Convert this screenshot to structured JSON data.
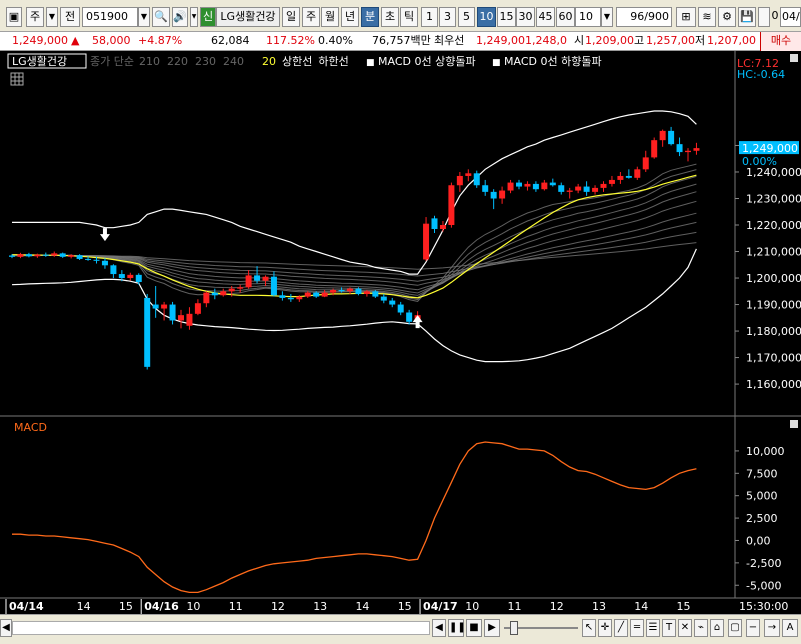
{
  "toolbar": {
    "market_btn": "주",
    "prev_btn": "전",
    "stock_code": "051900",
    "info_badge": "신",
    "stock_name": "LG생활건강",
    "periods": [
      "일",
      "주",
      "월",
      "년",
      "분",
      "초",
      "틱"
    ],
    "selected_period": "분",
    "intervals": [
      "1",
      "3",
      "5",
      "10",
      "15",
      "30",
      "45",
      "60"
    ],
    "selected_interval": "10",
    "interval_select": "10",
    "count_value": "96",
    "count_max": "/900",
    "checkbox_value": "0",
    "date_field": "04/"
  },
  "quote": {
    "price": "1,249,000",
    "change": "58,000",
    "change_pct": "+4.87%",
    "volume": "62,084",
    "volume_ratio": "117.52%",
    "turnover": "0.40%",
    "amount": "76,757백만",
    "best_label": "최우선",
    "ask": "1,249,00",
    "bid": "1,248,0",
    "open_label": "시",
    "open": "1,209,00",
    "high_label": "고",
    "high": "1,257,00",
    "low_label": "저",
    "low": "1,207,00",
    "buy_btn": "매수"
  },
  "legend": {
    "stock": "LG생활건강",
    "ma_label": "종가 단순",
    "ma_periods": [
      "210",
      "220",
      "230",
      "240"
    ],
    "ma_last": "20",
    "upper_band": "상한선",
    "lower_band": "하한선",
    "signal_up": "MACD 0선 상향돌파",
    "signal_down": "MACD 0선 하향돌파"
  },
  "overlay": {
    "lc": "LC:7.12",
    "hc": "HC:-0.64",
    "current_price": "1,249,000",
    "current_pct": "0.00%",
    "macd_label": "MACD"
  },
  "colors": {
    "background": "#000000",
    "up": "#ff2020",
    "down": "#00bfff",
    "band": "#ffffff",
    "ma20": "#ffff33",
    "macd": "#ff6a1a",
    "price_tag": "#00bfff"
  },
  "chart_data": [
    {
      "type": "candlestick",
      "title": "",
      "yticks": [
        1160000,
        1170000,
        1180000,
        1190000,
        1200000,
        1210000,
        1220000,
        1230000,
        1240000,
        1250000
      ],
      "ytick_labels": [
        "1,160,000",
        "1,170,000",
        "1,180,000",
        "1,190,000",
        "1,200,000",
        "1,210,000",
        "1,220,000",
        "1,230,000",
        "1,240,000",
        "1,250,000"
      ],
      "ylim": [
        1154000,
        1263000
      ],
      "x_labels": [
        "04/14",
        "14",
        "15",
        "04/16",
        "10",
        "11",
        "12",
        "13",
        "14",
        "15",
        "04/17",
        "10",
        "11",
        "12",
        "13",
        "14",
        "15"
      ],
      "x_label_index": [
        0,
        8,
        13,
        16,
        21,
        26,
        31,
        36,
        41,
        46,
        49,
        54,
        59,
        64,
        69,
        74,
        79
      ],
      "time_label": "15:30:00",
      "candles": [
        [
          1208500,
          1209000,
          1207500,
          1208000
        ],
        [
          1208000,
          1209500,
          1207500,
          1209000
        ],
        [
          1209000,
          1209500,
          1207800,
          1208200
        ],
        [
          1208200,
          1209200,
          1207600,
          1208800
        ],
        [
          1208800,
          1209600,
          1208000,
          1208500
        ],
        [
          1208500,
          1210000,
          1208000,
          1209300
        ],
        [
          1209300,
          1209600,
          1207600,
          1208000
        ],
        [
          1208000,
          1209000,
          1207400,
          1208600
        ],
        [
          1208600,
          1209000,
          1206800,
          1207200
        ],
        [
          1207200,
          1208200,
          1206500,
          1206900
        ],
        [
          1206900,
          1208000,
          1205500,
          1206500
        ],
        [
          1206500,
          1207500,
          1203500,
          1204800
        ],
        [
          1204800,
          1205200,
          1200000,
          1201500
        ],
        [
          1201500,
          1203000,
          1198800,
          1200000
        ],
        [
          1200000,
          1202000,
          1199000,
          1201200
        ],
        [
          1201200,
          1201800,
          1197500,
          1198500
        ],
        [
          1192500,
          1194000,
          1165500,
          1166500
        ],
        [
          1190000,
          1197000,
          1185000,
          1188500
        ],
        [
          1188500,
          1191000,
          1184000,
          1190000
        ],
        [
          1190000,
          1191000,
          1182500,
          1184000
        ],
        [
          1184000,
          1188000,
          1181000,
          1186000
        ],
        [
          1182000,
          1189000,
          1180500,
          1186500
        ],
        [
          1186500,
          1192000,
          1186000,
          1190500
        ],
        [
          1190500,
          1195000,
          1189000,
          1194500
        ],
        [
          1194500,
          1196000,
          1192000,
          1193500
        ],
        [
          1193500,
          1196000,
          1193000,
          1195000
        ],
        [
          1195000,
          1197000,
          1193000,
          1196000
        ],
        [
          1196000,
          1197500,
          1194500,
          1196500
        ],
        [
          1196500,
          1203000,
          1196000,
          1201000
        ],
        [
          1201000,
          1204500,
          1198000,
          1199000
        ],
        [
          1199000,
          1201000,
          1197000,
          1200500
        ],
        [
          1200500,
          1202500,
          1193000,
          1193500
        ],
        [
          1193500,
          1195000,
          1191500,
          1192500
        ],
        [
          1192500,
          1194000,
          1191000,
          1192000
        ],
        [
          1192000,
          1193500,
          1191000,
          1193000
        ],
        [
          1193000,
          1195000,
          1192500,
          1194500
        ],
        [
          1194500,
          1195000,
          1192500,
          1193000
        ],
        [
          1193000,
          1195500,
          1192800,
          1194500
        ],
        [
          1194500,
          1196000,
          1193500,
          1195500
        ],
        [
          1195500,
          1196500,
          1194500,
          1195000
        ],
        [
          1195000,
          1196500,
          1194000,
          1196000
        ],
        [
          1196000,
          1196500,
          1193500,
          1194000
        ],
        [
          1194000,
          1195500,
          1193000,
          1195000
        ],
        [
          1195000,
          1195500,
          1192500,
          1193000
        ],
        [
          1193000,
          1194000,
          1190500,
          1191500
        ],
        [
          1191500,
          1192500,
          1189000,
          1190000
        ],
        [
          1190000,
          1191000,
          1186000,
          1187000
        ],
        [
          1187000,
          1188000,
          1182500,
          1183500
        ],
        [
          1183500,
          1187500,
          1182500,
          1186000
        ],
        [
          1207000,
          1223000,
          1206500,
          1220500
        ],
        [
          1222500,
          1223500,
          1217000,
          1218500
        ],
        [
          1218500,
          1221500,
          1217500,
          1220000
        ],
        [
          1220000,
          1236000,
          1219000,
          1235000
        ],
        [
          1235000,
          1240000,
          1232500,
          1238500
        ],
        [
          1238500,
          1241000,
          1236500,
          1239500
        ],
        [
          1239500,
          1240500,
          1234000,
          1235000
        ],
        [
          1235000,
          1237000,
          1231000,
          1232500
        ],
        [
          1232500,
          1233500,
          1226000,
          1230000
        ],
        [
          1230000,
          1234500,
          1228000,
          1233000
        ],
        [
          1233000,
          1237000,
          1232000,
          1236000
        ],
        [
          1236000,
          1237000,
          1233500,
          1234500
        ],
        [
          1234500,
          1236500,
          1233000,
          1235500
        ],
        [
          1235500,
          1236500,
          1232500,
          1233500
        ],
        [
          1233500,
          1237000,
          1233000,
          1236000
        ],
        [
          1236000,
          1237500,
          1234500,
          1235000
        ],
        [
          1235000,
          1236000,
          1231500,
          1232500
        ],
        [
          1232500,
          1234000,
          1230000,
          1233000
        ],
        [
          1233000,
          1235500,
          1232000,
          1234500
        ],
        [
          1234500,
          1236500,
          1231000,
          1232500
        ],
        [
          1232500,
          1235000,
          1231500,
          1234000
        ],
        [
          1234000,
          1236500,
          1232500,
          1235500
        ],
        [
          1235500,
          1238500,
          1234500,
          1237000
        ],
        [
          1237000,
          1240000,
          1235500,
          1238500
        ],
        [
          1238500,
          1241000,
          1237500,
          1237800
        ],
        [
          1237800,
          1242000,
          1237000,
          1241000
        ],
        [
          1241000,
          1248000,
          1240000,
          1245500
        ],
        [
          1245500,
          1253000,
          1245000,
          1252000
        ],
        [
          1252000,
          1256000,
          1249500,
          1255500
        ],
        [
          1255500,
          1257000,
          1250000,
          1250500
        ],
        [
          1250500,
          1253000,
          1246000,
          1247500
        ],
        [
          1247500,
          1249000,
          1244000,
          1248000
        ],
        [
          1248000,
          1251000,
          1246500,
          1249000
        ]
      ],
      "ma20": [
        1208800,
        1208800,
        1208700,
        1208700,
        1208600,
        1208600,
        1208500,
        1208400,
        1208200,
        1208000,
        1207700,
        1207400,
        1207000,
        1206500,
        1206000,
        1205300,
        1203500,
        1202000,
        1200700,
        1199300,
        1198000,
        1196800,
        1195800,
        1195000,
        1194400,
        1194000,
        1193700,
        1193500,
        1193500,
        1193500,
        1193400,
        1193300,
        1193100,
        1193000,
        1193000,
        1193300,
        1193600,
        1193800,
        1194000,
        1194000,
        1194100,
        1194200,
        1194300,
        1194200,
        1194000,
        1193700,
        1193300,
        1192800,
        1192500,
        1193500,
        1194800,
        1196200,
        1198400,
        1200800,
        1203200,
        1205400,
        1207600,
        1209700,
        1211900,
        1214100,
        1216400,
        1218500,
        1220600,
        1222700,
        1224700,
        1226500,
        1228200,
        1229500,
        1230300,
        1230900,
        1231400,
        1231700,
        1232000,
        1232300,
        1232700,
        1233400,
        1234300,
        1235400,
        1236300,
        1237100,
        1238000,
        1238800
      ],
      "bb_upper": [
        1221000,
        1221000,
        1221000,
        1221000,
        1221000,
        1221000,
        1221000,
        1221000,
        1221000,
        1220500,
        1220000,
        1219000,
        1219000,
        1219500,
        1220000,
        1221000,
        1224000,
        1225000,
        1226000,
        1226000,
        1225500,
        1225000,
        1224500,
        1224000,
        1223000,
        1222000,
        1221000,
        1219500,
        1218500,
        1217500,
        1216500,
        1215500,
        1214500,
        1213500,
        1212000,
        1211000,
        1210000,
        1209000,
        1208000,
        1207000,
        1206000,
        1205500,
        1205000,
        1204000,
        1203500,
        1203000,
        1202500,
        1201500,
        1201500,
        1206000,
        1212000,
        1218000,
        1225000,
        1231000,
        1235000,
        1238000,
        1241000,
        1243000,
        1245000,
        1246500,
        1248000,
        1249500,
        1250500,
        1252000,
        1253000,
        1254000,
        1255000,
        1256000,
        1257000,
        1258000,
        1259000,
        1260000,
        1260800,
        1261500,
        1262000,
        1262500,
        1263000,
        1263000,
        1262700,
        1262000,
        1261000,
        1258000
      ],
      "bb_lower": [
        1197500,
        1197600,
        1197800,
        1197900,
        1198000,
        1198100,
        1198200,
        1198400,
        1198700,
        1199000,
        1199300,
        1199500,
        1199500,
        1199300,
        1198800,
        1198000,
        1192000,
        1188500,
        1186000,
        1184500,
        1183500,
        1182800,
        1182300,
        1182000,
        1181700,
        1181500,
        1181300,
        1181000,
        1180700,
        1180500,
        1180300,
        1180200,
        1180300,
        1180500,
        1180700,
        1181000,
        1181200,
        1181400,
        1181500,
        1181800,
        1182000,
        1182300,
        1182600,
        1183000,
        1183300,
        1183500,
        1183200,
        1182800,
        1182700,
        1180000,
        1177000,
        1174500,
        1172500,
        1171000,
        1170000,
        1169000,
        1168500,
        1168500,
        1168500,
        1168600,
        1168800,
        1169200,
        1169800,
        1170500,
        1171500,
        1172500,
        1173500,
        1175000,
        1176500,
        1178000,
        1179500,
        1181000,
        1183000,
        1185000,
        1187000,
        1189000,
        1191500,
        1194000,
        1197000,
        1200000,
        1204000,
        1211000
      ],
      "signal_up_index": [
        48
      ],
      "signal_down_index": [
        11
      ]
    },
    {
      "type": "line",
      "title": "MACD",
      "yticks": [
        -5000,
        -2500,
        0,
        2500,
        5000,
        7500,
        10000
      ],
      "ytick_labels": [
        "-5,000",
        "-2,500",
        "0,00",
        "2,500",
        "5,000",
        "7,500",
        "10,000"
      ],
      "ylim": [
        -6200,
        12000
      ],
      "macd": [
        700,
        700,
        600,
        600,
        500,
        500,
        400,
        300,
        200,
        100,
        -100,
        -300,
        -500,
        -900,
        -1300,
        -1800,
        -3000,
        -3800,
        -4600,
        -5200,
        -5600,
        -5800,
        -5800,
        -5500,
        -5100,
        -4700,
        -4200,
        -3800,
        -3400,
        -3100,
        -2800,
        -2600,
        -2500,
        -2400,
        -2300,
        -2200,
        -2000,
        -1900,
        -1800,
        -1700,
        -1600,
        -1500,
        -1500,
        -1600,
        -1700,
        -1800,
        -2000,
        -2200,
        -2100,
        0,
        2500,
        4500,
        6500,
        8500,
        10000,
        10800,
        11000,
        10900,
        10800,
        10500,
        10200,
        10200,
        10100,
        10000,
        9500,
        8800,
        8200,
        7800,
        7700,
        7400,
        7000,
        6600,
        6200,
        5900,
        5800,
        5700,
        5900,
        6400,
        7000,
        7500,
        7800,
        8000
      ]
    }
  ]
}
